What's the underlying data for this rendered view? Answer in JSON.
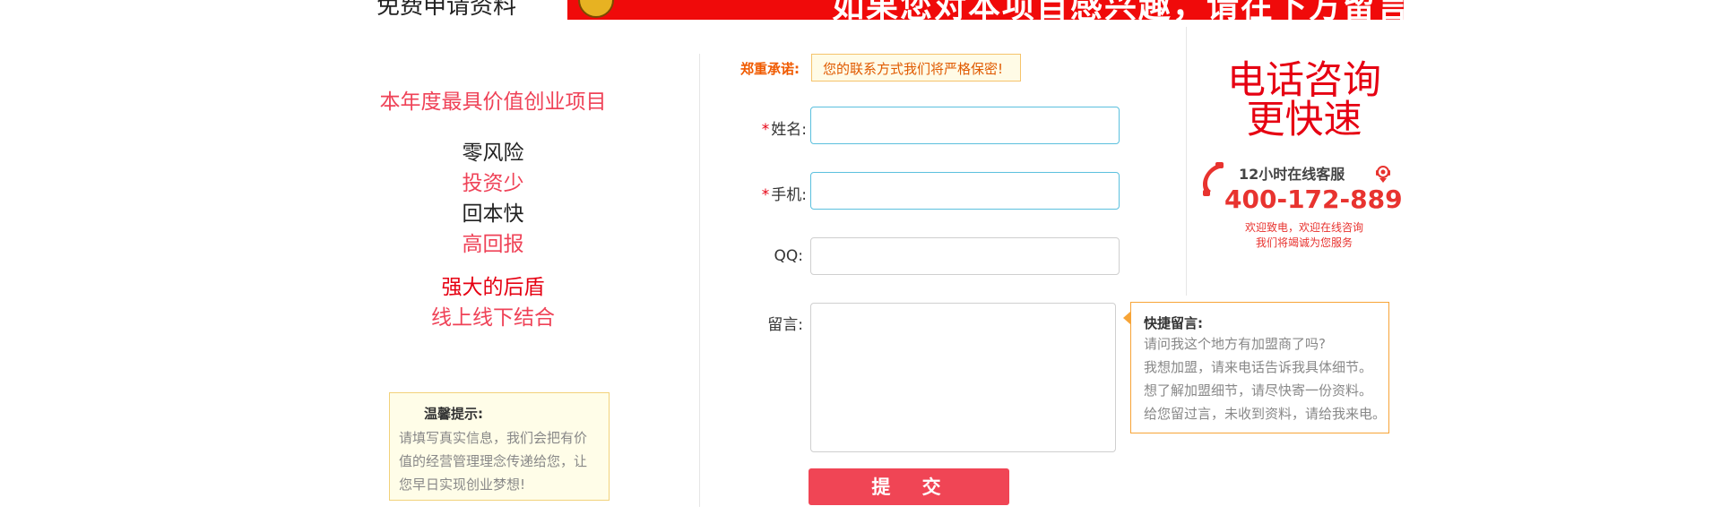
{
  "header": {
    "left_title": "免费申请资料",
    "banner_text": "如果您对本项目感兴趣，请在下方留言"
  },
  "left": {
    "tagline": "本年度最具价值创业项目",
    "features": [
      "零风险",
      "投资少",
      "回本快",
      "高回报"
    ],
    "backing": [
      "强大的后盾",
      "线上线下结合"
    ],
    "tip": {
      "title": "温馨提示:",
      "body": "请填写真实信息，我们会把有价值的经营管理理念传递给您，让您早日实现创业梦想!"
    }
  },
  "form": {
    "promise_label": "郑重承诺:",
    "promise_text": "您的联系方式我们将严格保密!",
    "fields": {
      "name": {
        "label": "姓名:",
        "required": "*",
        "value": ""
      },
      "phone": {
        "label": "手机:",
        "required": "*",
        "value": ""
      },
      "qq": {
        "label": "QQ:",
        "value": ""
      },
      "message": {
        "label": "留言:",
        "value": ""
      }
    },
    "submit_label": "提 交",
    "quick": {
      "title": "快捷留言:",
      "items": [
        "请问我这个地方有加盟商了吗?",
        "我想加盟，请来电话告诉我具体细节。",
        "想了解加盟细节，请尽快寄一份资料。",
        "给您留过言，未收到资料，请给我来电。"
      ]
    }
  },
  "contact": {
    "headline_line1": "电话咨询",
    "headline_line2": "更快速",
    "service_label": "12小时在线客服",
    "phone": "400-172-889",
    "welcome_line1": "欢迎致电，欢迎在线咨询",
    "welcome_line2": "我们将竭诚为您服务"
  },
  "colors": {
    "accent_red": "#e60012",
    "pink": "#ef4257",
    "orange": "#f05a00",
    "submit": "#f04555",
    "input_border": "#5bc0de"
  },
  "icons": [
    "phone-icon",
    "customer-service-icon",
    "badge-icon"
  ]
}
